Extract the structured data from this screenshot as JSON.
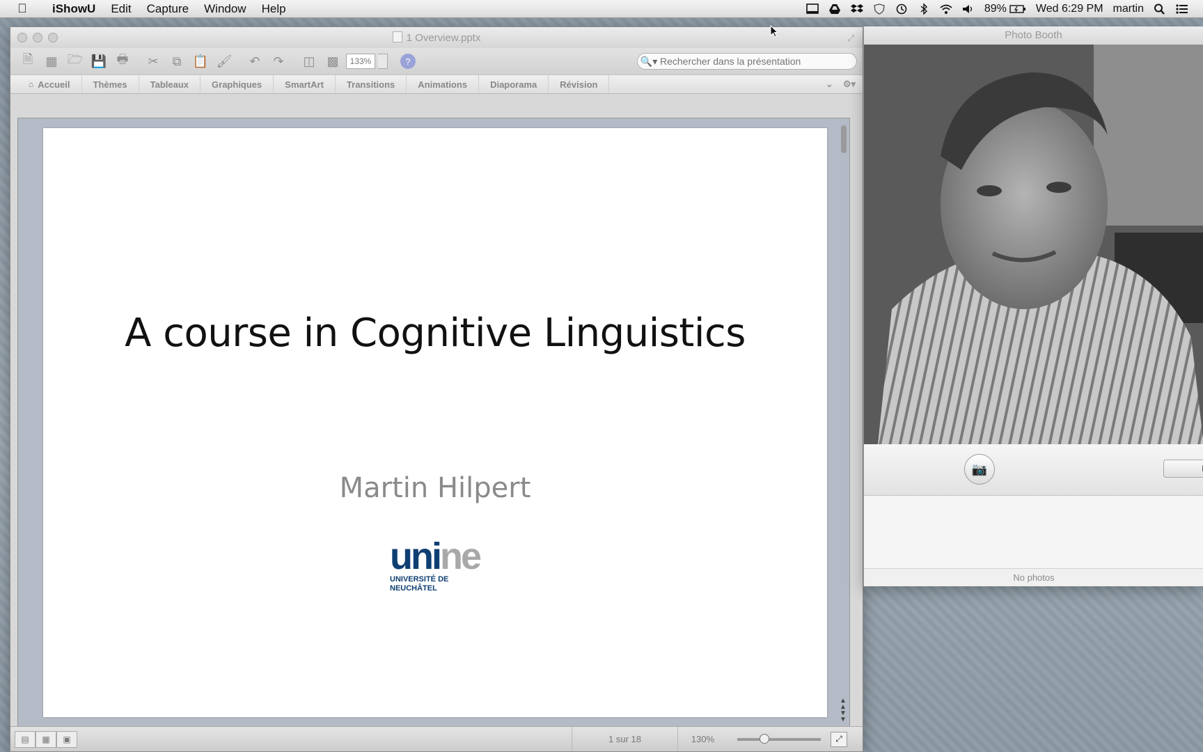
{
  "menubar": {
    "app_name": "iShowU",
    "items": [
      "Edit",
      "Capture",
      "Window",
      "Help"
    ],
    "battery": "89%",
    "clock": "Wed 6:29 PM",
    "user": "martin"
  },
  "powerpoint": {
    "title": "1 Overview.pptx",
    "zoom_field": "133%",
    "search_placeholder": "Rechercher dans la présentation",
    "ribbon_tabs": [
      "Accueil",
      "Thèmes",
      "Tableaux",
      "Graphiques",
      "SmartArt",
      "Transitions",
      "Animations",
      "Diaporama",
      "Révision"
    ],
    "slide": {
      "title": "A course in Cognitive Linguistics",
      "author": "Martin Hilpert",
      "logo_uni": "uni",
      "logo_ne": "ne",
      "logo_line1": "UNIVERSITÉ DE",
      "logo_line2": "NEUCHÂTEL"
    },
    "status": {
      "slide_counter": "1 sur 18",
      "zoom": "130%",
      "zoom_level_fraction": 0.3
    }
  },
  "photobooth": {
    "title": "Photo Booth",
    "effects_label": "E",
    "status": "No photos"
  },
  "colors": {
    "unine_blue": "#0f3f72",
    "unine_grey": "#a9a9a9",
    "help_button": "#9aa3d8"
  }
}
